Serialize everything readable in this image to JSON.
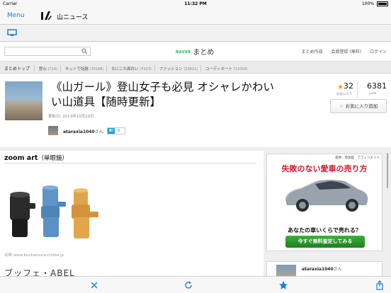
{
  "status_bar": {
    "carrier": "Carrier",
    "time": "11:32 PM",
    "battery": "100%"
  },
  "nav": {
    "menu_label": "Menu",
    "app_title": "山ニュース"
  },
  "site_header": {
    "brand_prefix": "NAVER",
    "brand": "まとめ",
    "links": [
      "まとめ作成",
      "会員登録 (無料)",
      "ログイン"
    ]
  },
  "breadcrumb": {
    "top": "まとめトップ",
    "categories": [
      {
        "label": "登山",
        "count": "(724)"
      },
      {
        "label": "ネットで話題",
        "count": "(70188)"
      },
      {
        "label": "なにこれ面白い",
        "count": "(7423)"
      },
      {
        "label": "ファッション",
        "count": "(20821)"
      },
      {
        "label": "コーディネート",
        "count": "(11054)"
      }
    ]
  },
  "article": {
    "title": "《山ガール》登山女子も必見 オシャレかわいい山道具【随時更新】",
    "updated": "更新日: 2013年10月19日",
    "author": "ataraxia1040",
    "author_suffix": "さん",
    "bookmark_label": "B!",
    "bookmark_count": "0",
    "favorites": "32",
    "favorites_label": "お気に入り",
    "views": "6381",
    "views_label": "view",
    "add_favorite_label": "お気に入り追加"
  },
  "content": {
    "section_title": "zoom art",
    "section_sub": "（単眼鏡）",
    "source": "出典 www.bunkamura-ichiba.jp",
    "next_heading": "ブッフェ・ABEL"
  },
  "ad": {
    "top_text": "提供：参加型　アフィリエイト",
    "title": "失敗のない愛車の売り方",
    "question": "あなたの車いくらで売れる？",
    "button": "今すぐ無料査定してみる"
  },
  "sidebar_card": {
    "name": "ataraxia1040",
    "suffix": "さん"
  },
  "colors": {
    "link_blue": "#1a7fd9",
    "naver_green": "#1cb24a",
    "ad_red": "#e0142c",
    "star": "#f0a000"
  },
  "toolbar_icons": [
    "close-icon",
    "refresh-icon",
    "star-icon",
    "share-icon"
  ]
}
